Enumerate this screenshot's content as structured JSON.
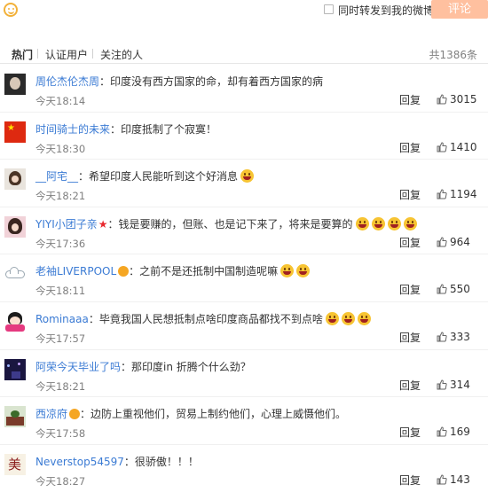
{
  "composer": {
    "emoji_icon": "smiley-icon",
    "repost_label": "同时转发到我的微博",
    "comment_button": "评论"
  },
  "tabs": {
    "items": [
      "热门",
      "认证用户",
      "关注的人"
    ],
    "total": "共1386条"
  },
  "labels": {
    "reply": "回复"
  },
  "comments": [
    {
      "user": "周伦杰伦杰周",
      "text": "：印度没有西方国家的命，却有着西方国家的病",
      "time": "今天18:14",
      "likes": "3015",
      "faces": 0
    },
    {
      "user": "时间骑士的未来",
      "text": "：印度抵制了个寂寞！",
      "time": "今天18:30",
      "likes": "1410",
      "faces": 0
    },
    {
      "user": "__阿宅__",
      "text": "：希望印度人民能听到这个好消息",
      "time": "今天18:21",
      "likes": "1194",
      "faces": 1
    },
    {
      "user": "YIYI小团子亲",
      "text": "：钱是要赚的，但账、也是记下来了，将来是要算的",
      "time": "今天17:36",
      "likes": "964",
      "faces": 4
    },
    {
      "user": "老袖LIVERPOOL",
      "text": "：之前不是还抵制中国制造呢嘛",
      "time": "今天18:11",
      "likes": "550",
      "faces": 2
    },
    {
      "user": "Rominaaa",
      "text": "：毕竟我国人民想抵制点啥印度商品都找不到点啥",
      "time": "今天17:57",
      "likes": "333",
      "faces": 3
    },
    {
      "user": "阿荣今天毕业了吗",
      "text": "：那印度in 折腾个什么劲？",
      "time": "今天18:21",
      "likes": "314",
      "faces": 0
    },
    {
      "user": "西凉府",
      "text": "：边防上重视他们，贸易上制约他们，心理上威慑他们。",
      "time": "今天17:58",
      "likes": "169",
      "faces": 0
    },
    {
      "user": "Neverstop54597",
      "text": "：很骄傲！！！",
      "time": "今天18:27",
      "likes": "143",
      "faces": 0
    }
  ],
  "colors": {
    "username": "#eb7350",
    "comment_button_bg": "#ffc09f",
    "time": "#808080"
  }
}
